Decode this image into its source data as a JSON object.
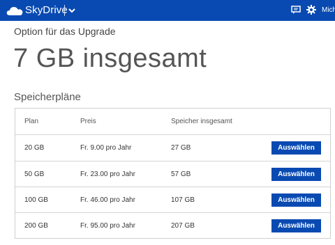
{
  "header": {
    "app_title": "SkyDrive",
    "user_name": "Mich"
  },
  "page": {
    "upgrade_label": "Option für das Upgrade",
    "total_storage": "7 GB insgesamt",
    "plans_title": "Speicherpläne"
  },
  "table": {
    "columns": {
      "plan": "Plan",
      "price": "Preis",
      "storage": "Speicher insgesamt"
    },
    "rows": [
      {
        "plan": "20 GB",
        "price": "Fr. 9.00 pro Jahr",
        "storage": "27 GB",
        "button": "Auswählen"
      },
      {
        "plan": "50 GB",
        "price": "Fr. 23.00 pro Jahr",
        "storage": "57 GB",
        "button": "Auswählen"
      },
      {
        "plan": "100 GB",
        "price": "Fr. 46.00 pro Jahr",
        "storage": "107 GB",
        "button": "Auswählen"
      },
      {
        "plan": "200 GB",
        "price": "Fr. 95.00 pro Jahr",
        "storage": "207 GB",
        "button": "Auswählen"
      }
    ]
  },
  "colors": {
    "brand_blue": "#094ab2"
  },
  "icons": [
    "cloud-icon",
    "chevron-down-icon",
    "message-icon",
    "gear-icon"
  ]
}
